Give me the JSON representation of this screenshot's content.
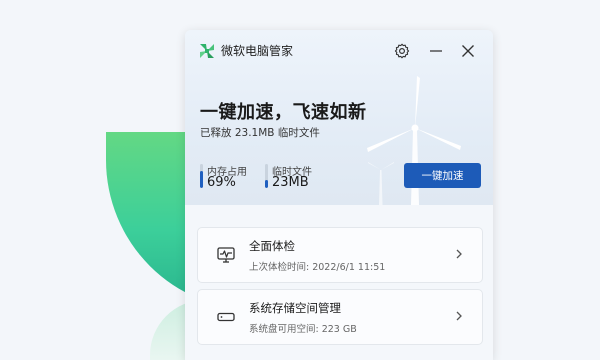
{
  "app": {
    "title": "微软电脑管家"
  },
  "hero": {
    "headline": "一键加速，飞速如新",
    "released": "已释放 23.1MB 临时文件",
    "accelerate_button": "一键加速",
    "stats": [
      {
        "label": "内存占用",
        "value": "69%",
        "level": 0.69
      },
      {
        "label": "临时文件",
        "value": "23MB",
        "level": 0.35
      }
    ]
  },
  "cards": [
    {
      "title": "全面体检",
      "subtitle": "上次体检时间: 2022/6/1 11:51",
      "icon": "health-monitor-icon"
    },
    {
      "title": "系统存储空间管理",
      "subtitle": "系统盘可用空间: 223 GB",
      "icon": "storage-drive-icon"
    }
  ],
  "colors": {
    "accent": "#1d5bb8",
    "logo_green": "#2fb36b",
    "bg_green": "#3ccf9a"
  }
}
